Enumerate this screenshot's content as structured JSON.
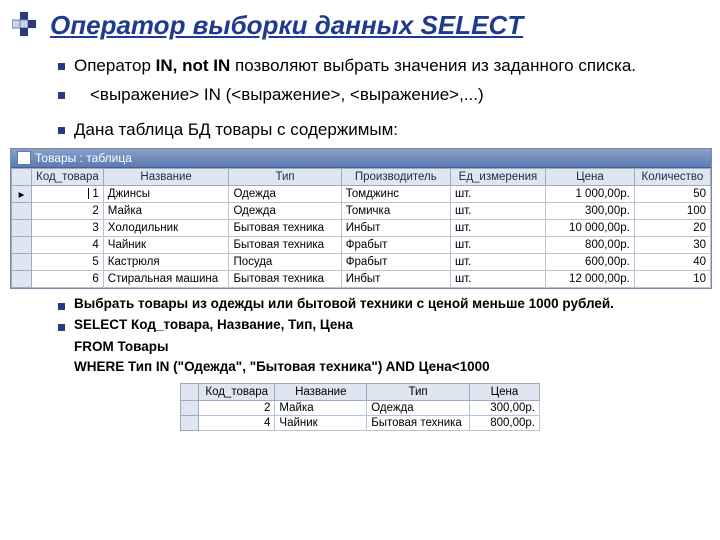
{
  "logo_squares": 5,
  "title": "Оператор выборки данных SELECT",
  "bullets": {
    "b1_pre": "Оператор ",
    "b1_op": "IN, not IN",
    "b1_post": " позволяют выбрать значения из заданного списка.",
    "b2": "<выражение> IN (<выражение>, <выражение>,...)",
    "b3": "Дана таблица БД товары с содержимым:",
    "b4": "Выбрать товары из одежды или бытовой техники с ценой меньше 1000 рублей.",
    "b5": "SELECT Код_товара, Название, Тип, Цена"
  },
  "code": {
    "l1": "FROM Товары",
    "l2": "WHERE Тип IN (\"Одежда\", \"Бытовая техника\") AND Цена<1000"
  },
  "db": {
    "windowTitle": "Товары : таблица",
    "headers": [
      "Код_товара",
      "Название",
      "Тип",
      "Производитель",
      "Ед_измерения",
      "Цена",
      "Количество"
    ],
    "rows": [
      {
        "id": "1",
        "name": "Джинсы",
        "type": "Одежда",
        "maker": "Томджинс",
        "unit": "шт.",
        "price": "1 000,00р.",
        "qty": "50"
      },
      {
        "id": "2",
        "name": "Майка",
        "type": "Одежда",
        "maker": "Томичка",
        "unit": "шт.",
        "price": "300,00р.",
        "qty": "100"
      },
      {
        "id": "3",
        "name": "Холодильник",
        "type": "Бытовая техника",
        "maker": "Инбыт",
        "unit": "шт.",
        "price": "10 000,00р.",
        "qty": "20"
      },
      {
        "id": "4",
        "name": "Чайник",
        "type": "Бытовая техника",
        "maker": "Фрабыт",
        "unit": "шт.",
        "price": "800,00р.",
        "qty": "30"
      },
      {
        "id": "5",
        "name": "Кастрюля",
        "type": "Посуда",
        "maker": "Фрабыт",
        "unit": "шт.",
        "price": "600,00р.",
        "qty": "40"
      },
      {
        "id": "6",
        "name": "Стиральная машина",
        "type": "Бытовая техника",
        "maker": "Инбыт",
        "unit": "шт.",
        "price": "12 000,00р.",
        "qty": "10"
      }
    ]
  },
  "result": {
    "headers": [
      "Код_товара",
      "Название",
      "Тип",
      "Цена"
    ],
    "rows": [
      {
        "id": "2",
        "name": "Майка",
        "type": "Одежда",
        "price": "300,00р."
      },
      {
        "id": "4",
        "name": "Чайник",
        "type": "Бытовая техника",
        "price": "800,00р."
      }
    ]
  },
  "chart_data": {
    "type": "table",
    "title": "Товары",
    "columns": [
      "Код_товара",
      "Название",
      "Тип",
      "Производитель",
      "Ед_измерения",
      "Цена",
      "Количество"
    ],
    "rows": [
      [
        1,
        "Джинсы",
        "Одежда",
        "Томджинс",
        "шт.",
        1000.0,
        50
      ],
      [
        2,
        "Майка",
        "Одежда",
        "Томичка",
        "шт.",
        300.0,
        100
      ],
      [
        3,
        "Холодильник",
        "Бытовая техника",
        "Инбыт",
        "шт.",
        10000.0,
        20
      ],
      [
        4,
        "Чайник",
        "Бытовая техника",
        "Фрабыт",
        "шт.",
        800.0,
        30
      ],
      [
        5,
        "Кастрюля",
        "Посуда",
        "Фрабыт",
        "шт.",
        600.0,
        40
      ],
      [
        6,
        "Стиральная машина",
        "Бытовая техника",
        "Инбыт",
        "шт.",
        12000.0,
        10
      ]
    ]
  }
}
